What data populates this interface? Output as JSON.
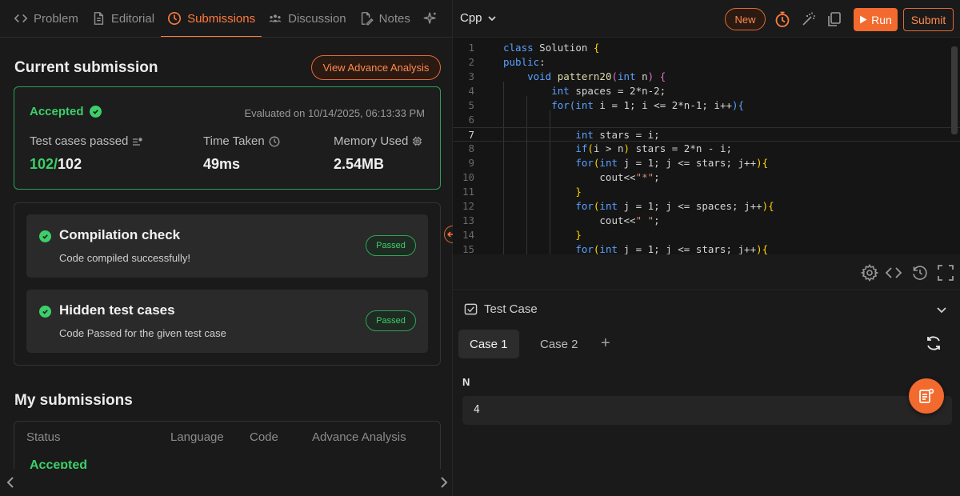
{
  "left_tabs": [
    {
      "label": "Problem",
      "icon": "code-brackets-icon"
    },
    {
      "label": "Editorial",
      "icon": "document-icon"
    },
    {
      "label": "Submissions",
      "icon": "clock-icon",
      "active": true
    },
    {
      "label": "Discussion",
      "icon": "people-icon"
    },
    {
      "label": "Notes",
      "icon": "note-edit-icon"
    }
  ],
  "current_submission": {
    "title": "Current submission",
    "advance_button": "View Advance Analysis",
    "status": "Accepted",
    "evaluated": "Evaluated on 10/14/2025, 06:13:33 PM",
    "stats": [
      {
        "label": "Test cases passed",
        "value_main": "102/",
        "value_rest": "102"
      },
      {
        "label": "Time Taken",
        "value": "49ms"
      },
      {
        "label": "Memory Used",
        "value": "2.54MB"
      }
    ]
  },
  "checks": [
    {
      "title": "Compilation check",
      "subtitle": "Code compiled successfully!",
      "badge": "Passed"
    },
    {
      "title": "Hidden test cases",
      "subtitle": "Code Passed for the given test case",
      "badge": "Passed"
    }
  ],
  "my_submissions": {
    "title": "My submissions",
    "columns": [
      "Status",
      "Language",
      "Code",
      "Advance Analysis"
    ],
    "rows": [
      {
        "status": "Accepted"
      }
    ]
  },
  "editor": {
    "language": "Cpp",
    "new_label": "New",
    "run_label": "Run",
    "submit_label": "Submit",
    "current_line": 7,
    "lines": [
      {
        "n": "1"
      },
      {
        "n": "2"
      },
      {
        "n": "3"
      },
      {
        "n": "4"
      },
      {
        "n": "5"
      },
      {
        "n": "6"
      },
      {
        "n": "7"
      },
      {
        "n": "8"
      },
      {
        "n": "9"
      },
      {
        "n": "10"
      },
      {
        "n": "11"
      },
      {
        "n": "12"
      },
      {
        "n": "13"
      },
      {
        "n": "14"
      },
      {
        "n": "15"
      }
    ]
  },
  "testcase": {
    "title": "Test Case",
    "cases": [
      "Case 1",
      "Case 2"
    ],
    "active_case": 0,
    "add_label": "+",
    "variables": [
      {
        "name": "N",
        "value": "4"
      }
    ]
  },
  "colors": {
    "accent": "#ff7a3d",
    "success": "#3ccf6a",
    "run": "#f26a2e"
  }
}
